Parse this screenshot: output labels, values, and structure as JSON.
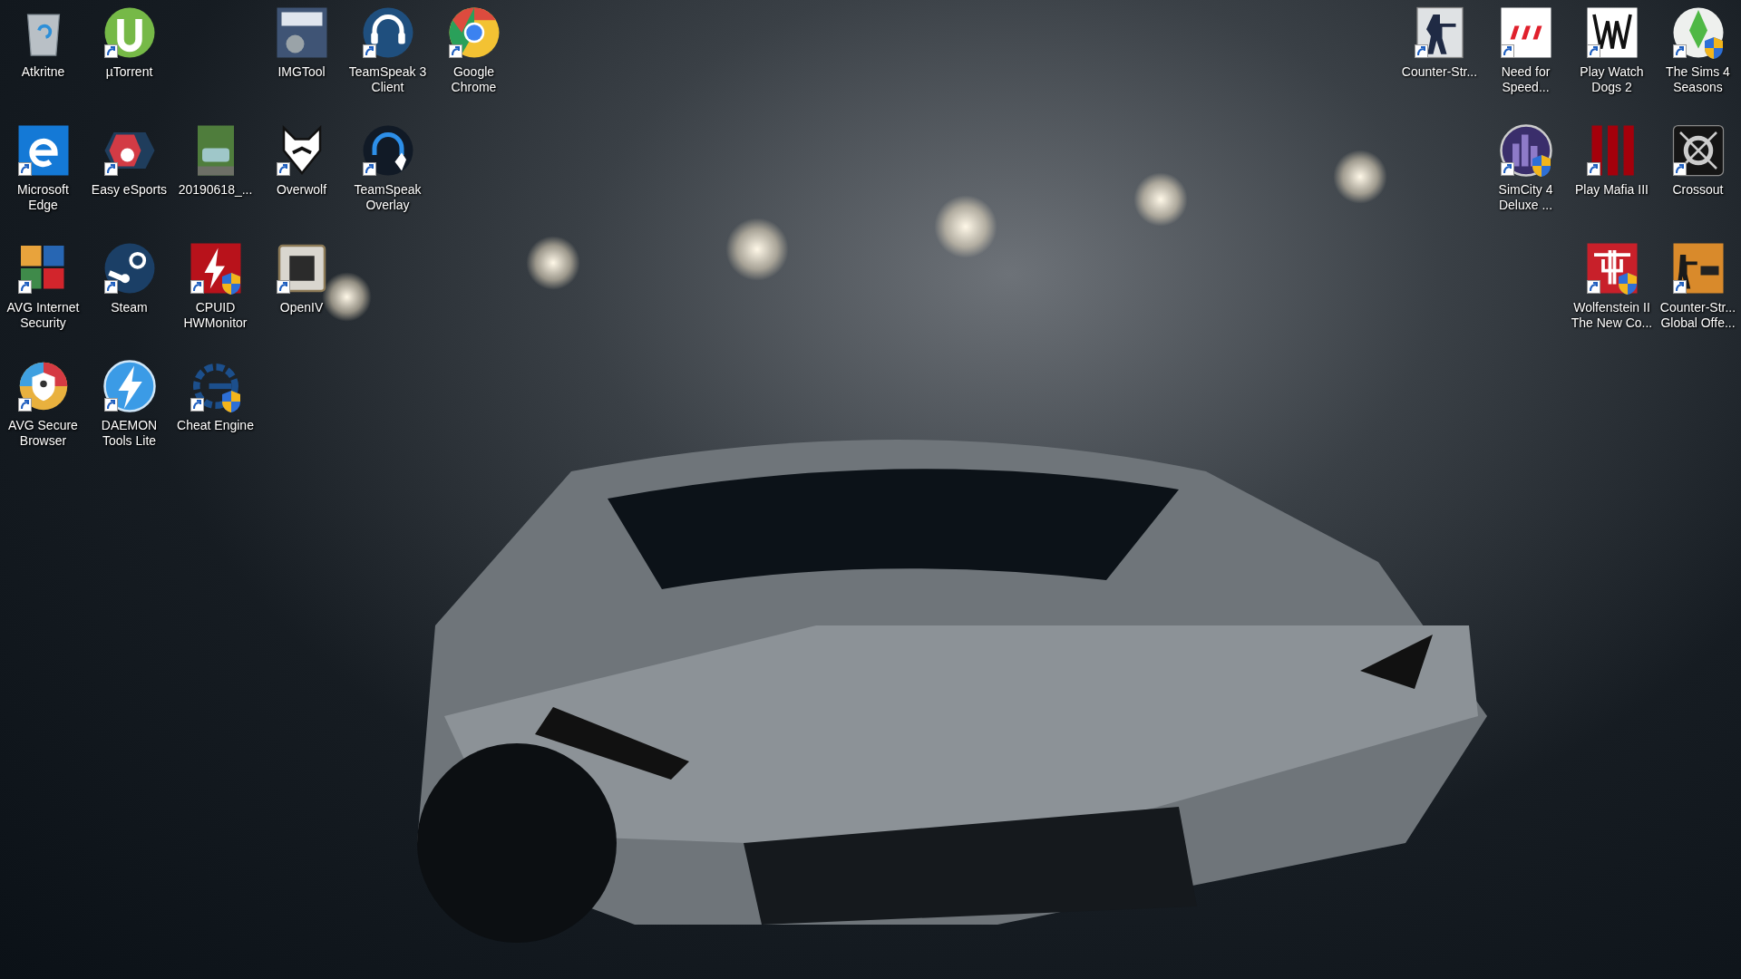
{
  "desktop": {
    "left_columns": [
      [
        {
          "label": "Atkritne",
          "kind": "bin",
          "shortcut": false,
          "admin": false
        },
        {
          "label": "Microsoft\nEdge",
          "kind": "edge",
          "shortcut": true,
          "admin": false
        },
        {
          "label": "AVG Internet\nSecurity",
          "kind": "avg",
          "shortcut": true,
          "admin": false
        },
        {
          "label": "AVG Secure\nBrowser",
          "kind": "avgbrowser",
          "shortcut": true,
          "admin": false
        }
      ],
      [
        {
          "label": "µTorrent",
          "kind": "torrent",
          "shortcut": true,
          "admin": false
        },
        {
          "label": "Easy eSports",
          "kind": "esports",
          "shortcut": true,
          "admin": false
        },
        {
          "label": "Steam",
          "kind": "steam",
          "shortcut": true,
          "admin": false
        },
        {
          "label": "DAEMON\nTools Lite",
          "kind": "daemon",
          "shortcut": true,
          "admin": false
        }
      ],
      [
        null,
        {
          "label": "20190618_...",
          "kind": "photo",
          "shortcut": false,
          "admin": false
        },
        {
          "label": "CPUID\nHWMonitor",
          "kind": "cpuid",
          "shortcut": true,
          "admin": true
        },
        {
          "label": "Cheat Engine",
          "kind": "cheat",
          "shortcut": true,
          "admin": true
        }
      ],
      [
        {
          "label": "IMGTool",
          "kind": "img",
          "shortcut": false,
          "admin": false
        },
        {
          "label": "Overwolf",
          "kind": "overwolf",
          "shortcut": true,
          "admin": false
        },
        {
          "label": "OpenIV",
          "kind": "openiv",
          "shortcut": true,
          "admin": false
        }
      ],
      [
        {
          "label": "TeamSpeak 3\nClient",
          "kind": "teamspeak",
          "shortcut": true,
          "admin": false
        },
        {
          "label": "TeamSpeak\nOverlay",
          "kind": "tsoverlay",
          "shortcut": true,
          "admin": false
        }
      ],
      [
        {
          "label": "Google\nChrome",
          "kind": "chrome",
          "shortcut": true,
          "admin": false
        }
      ]
    ],
    "right_columns": [
      [
        {
          "label": "Counter-Str...",
          "kind": "cs",
          "shortcut": true,
          "admin": false
        }
      ],
      [
        {
          "label": "Need for\nSpeed...",
          "kind": "nfs",
          "shortcut": true,
          "admin": false
        },
        {
          "label": "SimCity 4\nDeluxe ...",
          "kind": "simcity",
          "shortcut": true,
          "admin": true
        }
      ],
      [
        {
          "label": "Play Watch\nDogs 2",
          "kind": "watchdogs",
          "shortcut": true,
          "admin": false
        },
        {
          "label": "Play Mafia III",
          "kind": "mafia",
          "shortcut": true,
          "admin": false
        },
        {
          "label": "Wolfenstein II\nThe New Co...",
          "kind": "wolfenstein",
          "shortcut": true,
          "admin": true
        }
      ],
      [
        {
          "label": "The Sims 4\nSeasons",
          "kind": "sims",
          "shortcut": true,
          "admin": true
        },
        {
          "label": "Crossout",
          "kind": "crossout",
          "shortcut": true,
          "admin": false
        },
        {
          "label": "Counter-Str...\nGlobal Offe...",
          "kind": "csgo",
          "shortcut": true,
          "admin": false
        }
      ]
    ]
  }
}
